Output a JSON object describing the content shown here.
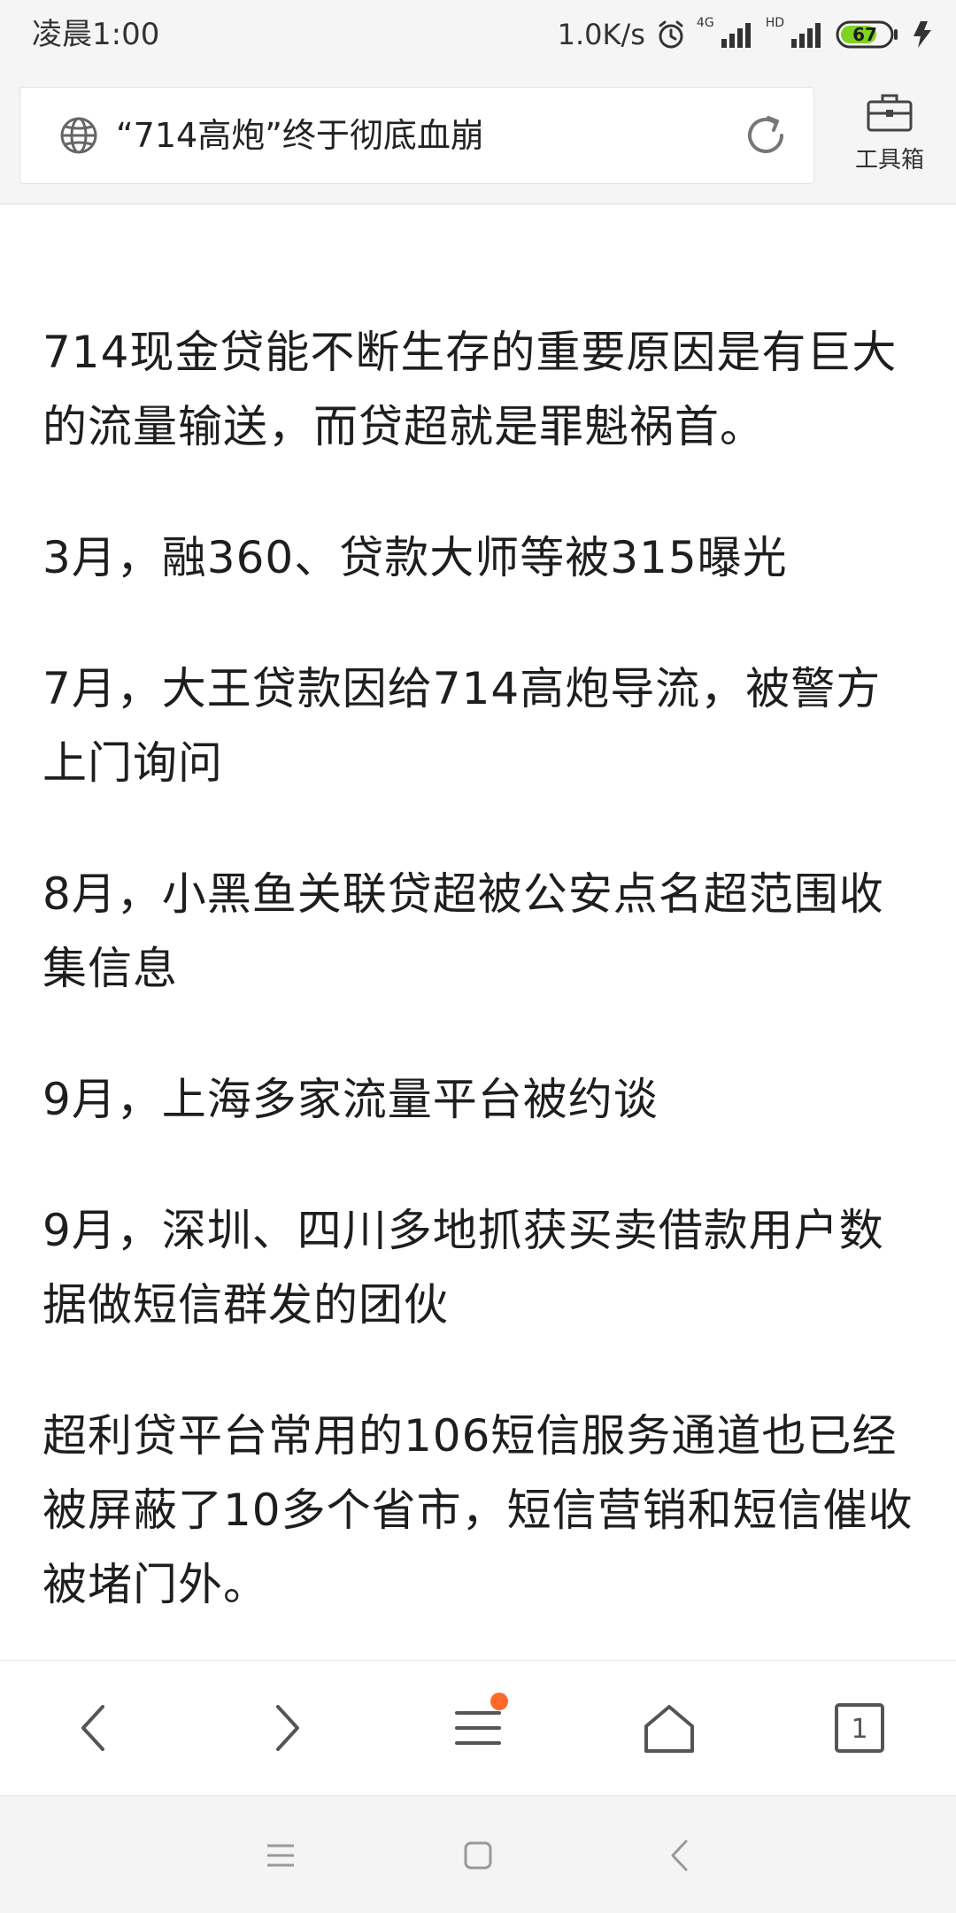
{
  "status_bar": {
    "time": "凌晨1:00",
    "net_speed": "1.0K/s",
    "network_4g": "4G",
    "network_hd": "HD",
    "battery": "67",
    "icons": [
      "alarm-icon",
      "signal-icon",
      "battery-icon",
      "charging-icon"
    ]
  },
  "address_bar": {
    "url_text": "“714高炮”终于彻底血崩",
    "toolbox_label": "工具箱",
    "icons": [
      "globe-icon",
      "refresh-icon",
      "toolbox-icon"
    ]
  },
  "article": {
    "paragraphs": [
      "714现金贷能不断生存的重要原因是有巨大的流量输送，而贷超就是罪魁祸首。",
      "3月，融360、贷款大师等被315曝光",
      "7月，大王贷款因给714高炮导流，被警方上门询问",
      "8月，小黑鱼关联贷超被公安点名超范围收集信息",
      "9月，上海多家流量平台被约谈",
      "9月，深圳、四川多地抓获买卖借款用户数据做短信群发的团伙",
      "超利贷平台常用的106短信服务通道也已经被屏蔽了10多个省市，短信营销和短信催收被堵门外。"
    ]
  },
  "bottom_nav": {
    "tab_count": "1",
    "accent_color": "#ff6a2b",
    "icons": [
      "back-icon",
      "forward-icon",
      "menu-icon",
      "home-icon",
      "tabs-icon"
    ]
  },
  "system_nav": {
    "icons": [
      "recents-icon",
      "home-square-icon",
      "back-chevron-icon"
    ]
  }
}
